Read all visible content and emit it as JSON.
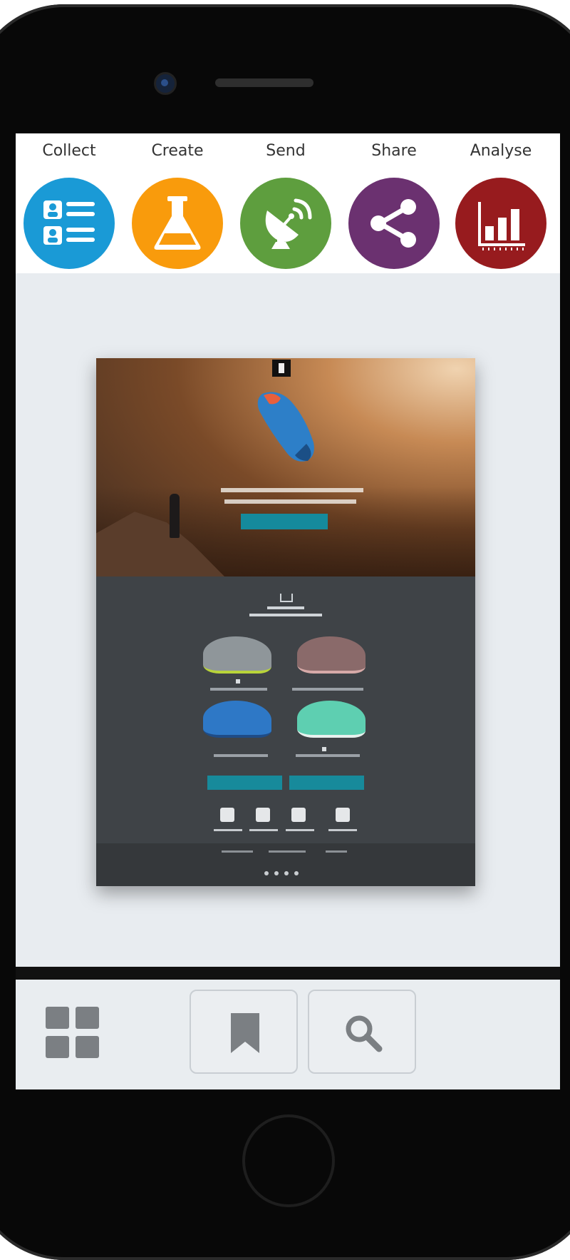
{
  "toolbar": {
    "items": [
      {
        "label": "Collect",
        "icon": "contact-list-icon",
        "color": "#1a9ad6"
      },
      {
        "label": "Create",
        "icon": "flask-icon",
        "color": "#f99b0c"
      },
      {
        "label": "Send",
        "icon": "satellite-dish-icon",
        "color": "#5e9e3e"
      },
      {
        "label": "Share",
        "icon": "share-icon",
        "color": "#6b3170"
      },
      {
        "label": "Analyse",
        "icon": "bar-chart-icon",
        "color": "#971b1e"
      }
    ]
  },
  "bottom_bar": {
    "icons": [
      "grid-icon",
      "bookmark-icon",
      "search-icon"
    ]
  },
  "colors": {
    "background": "#e8ecf0",
    "accent_cta": "#158a9c",
    "email_dark": "#3f4347"
  }
}
